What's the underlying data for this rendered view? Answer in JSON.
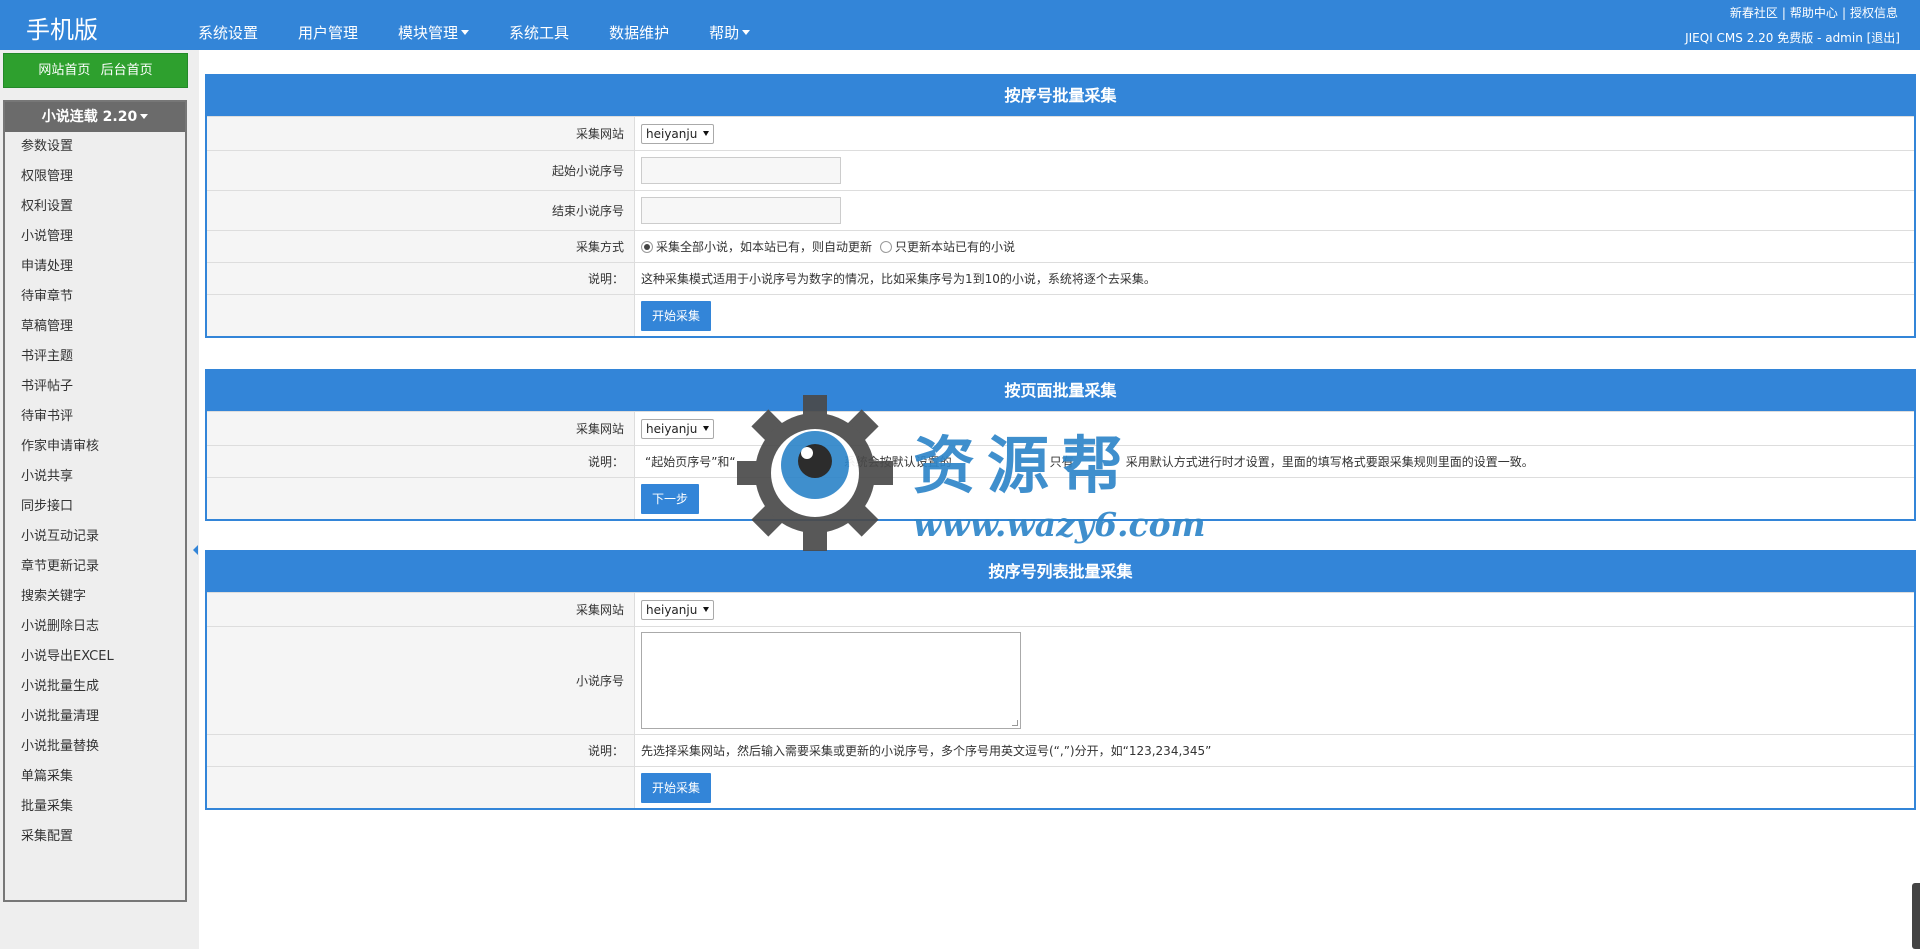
{
  "header": {
    "brand": "手机版",
    "nav": [
      {
        "label": "系统设置",
        "dropdown": false
      },
      {
        "label": "用户管理",
        "dropdown": false
      },
      {
        "label": "模块管理",
        "dropdown": true
      },
      {
        "label": "系统工具",
        "dropdown": false
      },
      {
        "label": "数据维护",
        "dropdown": false
      },
      {
        "label": "帮助",
        "dropdown": true
      }
    ],
    "links": [
      "新春社区",
      "帮助中心",
      "授权信息"
    ],
    "site_info": "JIEQI CMS 2.20 免费版 - admin [退出]"
  },
  "sidebar": {
    "home_links": [
      "网站首页",
      "后台首页"
    ],
    "menu_title": "小说连载 2.20",
    "items": [
      "参数设置",
      "权限管理",
      "权利设置",
      "小说管理",
      "申请处理",
      "待审章节",
      "草稿管理",
      "书评主题",
      "书评帖子",
      "待审书评",
      "作家申请审核",
      "小说共享",
      "同步接口",
      "小说互动记录",
      "章节更新记录",
      "搜索关键字",
      "小说删除日志",
      "小说导出EXCEL",
      "小说批量生成",
      "小说批量清理",
      "小说批量替换",
      "单篇采集",
      "批量采集",
      "采集配置"
    ]
  },
  "panel1": {
    "title": "按序号批量采集",
    "site_label": "采集网站",
    "site_value": "heiyanju",
    "start_label": "起始小说序号",
    "end_label": "结束小说序号",
    "mode_label": "采集方式",
    "mode_options": [
      "采集全部小说，如本站已有，则自动更新",
      "只更新本站已有的小说"
    ],
    "note_label": "说明：",
    "note": "这种采集模式适用于小说序号为数字的情况，比如采集序号为1到10的小说，系统将逐个去采集。",
    "button": "开始采集"
  },
  "panel2": {
    "title": "按页面批量采集",
    "site_label": "采集网站",
    "site_value": "heiyanju",
    "note_label": "说明：",
    "note_a": "“起始页序号”和“",
    "note_b": "系统会按默认设置的",
    "note_c": "只有",
    "note_d": "采用默认方式进行时才设置，里面的填写格式要跟采集规则里面的设置一致。",
    "button": "下一步"
  },
  "panel3": {
    "title": "按序号列表批量采集",
    "site_label": "采集网站",
    "site_value": "heiyanju",
    "ids_label": "小说序号",
    "note_label": "说明：",
    "note": "先选择采集网站，然后输入需要采集或更新的小说序号，多个序号用英文逗号(“,”)分开，如“123,234,345”",
    "button": "开始采集"
  },
  "watermark": {
    "name": "资源帮",
    "url": "www.wazy6.com"
  },
  "colors": {
    "primary": "#3385d8",
    "green": "#2ea02e",
    "sidebar_bg": "#eeeeee",
    "label_bg": "#f5f5f5"
  }
}
